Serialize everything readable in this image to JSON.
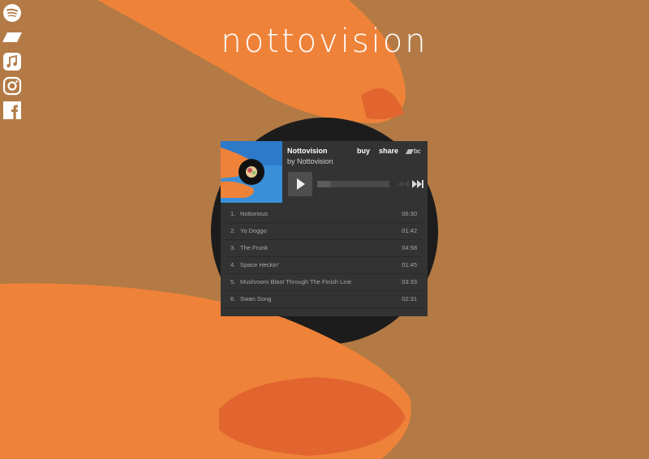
{
  "site": {
    "title": "nottovision"
  },
  "social": [
    {
      "name": "spotify-icon"
    },
    {
      "name": "tidal-icon"
    },
    {
      "name": "apple-music-icon"
    },
    {
      "name": "instagram-icon"
    },
    {
      "name": "facebook-icon"
    }
  ],
  "player": {
    "album_title": "Nottovision",
    "artist": "by Nottovision",
    "buy_label": "buy",
    "share_label": "share",
    "logo_text": "bc",
    "progress": 0.18,
    "tracks": [
      {
        "num": "1.",
        "name": "Nottorious",
        "duration": "06:30"
      },
      {
        "num": "2.",
        "name": "Yo Doggo",
        "duration": "01:42"
      },
      {
        "num": "3.",
        "name": "The Frunk",
        "duration": "04:58"
      },
      {
        "num": "4.",
        "name": "Space Heckin'",
        "duration": "01:45"
      },
      {
        "num": "5.",
        "name": "Mushroom Blast Through The Finish Line",
        "duration": "03:33"
      },
      {
        "num": "6.",
        "name": "Swan Song",
        "duration": "02:31"
      }
    ]
  },
  "colors": {
    "background": "#b37a45",
    "finger": "#ef8239",
    "disc": "#1c1c1c",
    "player": "#333333"
  }
}
